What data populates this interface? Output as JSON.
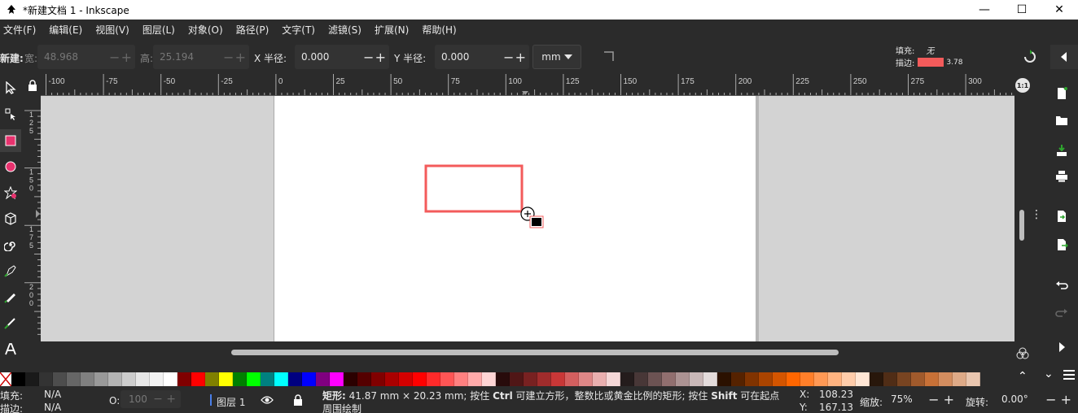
{
  "window": {
    "title": "*新建文档 1 - Inkscape",
    "minimize": "—",
    "maximize": "☐",
    "close": "✕"
  },
  "menu": [
    "文件(F)",
    "编辑(E)",
    "视图(V)",
    "图层(L)",
    "对象(O)",
    "路径(P)",
    "文字(T)",
    "滤镜(S)",
    "扩展(N)",
    "帮助(H)"
  ],
  "controls": {
    "new_label": "新建:",
    "width_label": "宽:",
    "width_value": "48.968",
    "height_label": "高:",
    "height_value": "25.194",
    "rx_label": "X 半径:",
    "rx_value": "0.000",
    "ry_label": "Y 半径:",
    "ry_value": "0.000",
    "unit": "mm",
    "fill_label": "填充:",
    "fill_value": "无",
    "stroke_label": "描边:",
    "stroke_width": "3.78"
  },
  "ruler_top": [
    "-100",
    "-75",
    "-50",
    "-25",
    "0",
    "25",
    "50",
    "75",
    "100",
    "125",
    "150",
    "175",
    "200",
    "225",
    "250",
    "275",
    "300"
  ],
  "ruler_left": [
    "1 2 5",
    "1 5 0",
    "1 7 5",
    "2 0 0"
  ],
  "zoom_reset_label": "1:1",
  "palette": [
    "#000000",
    "#1a1a1a",
    "#333333",
    "#4d4d4d",
    "#666666",
    "#808080",
    "#999999",
    "#b3b3b3",
    "#cccccc",
    "#e6e6e6",
    "#f2f2f2",
    "#ffffff",
    "#800000",
    "#ff0000",
    "#808000",
    "#ffff00",
    "#008000",
    "#00ff00",
    "#008080",
    "#00ffff",
    "#000080",
    "#0000ff",
    "#800080",
    "#ff00ff",
    "#2b0000",
    "#550000",
    "#800000",
    "#aa0000",
    "#d40000",
    "#ff0000",
    "#ff2a2a",
    "#ff5555",
    "#ff8080",
    "#ffaaaa",
    "#ffd5d5",
    "#280b0b",
    "#501616",
    "#782121",
    "#a02c2c",
    "#c83737",
    "#d35f5f",
    "#de8787",
    "#e9afaf",
    "#f4d7d7",
    "#241c1c",
    "#483737",
    "#6c5353",
    "#916f6f",
    "#ac9393",
    "#c8b7b7",
    "#e3dbdb",
    "#2b1100",
    "#552200",
    "#803300",
    "#aa4400",
    "#d45500",
    "#ff6600",
    "#ff7f2a",
    "#ff9955",
    "#ffb380",
    "#ffccaa",
    "#ffe6d5",
    "#28170b",
    "#502d16",
    "#784421",
    "#a05a2c",
    "#c87137",
    "#d38d5f",
    "#deaa87",
    "#e9c6af"
  ],
  "status": {
    "fill_label": "填充:",
    "fill_value": "N/A",
    "stroke_label": "描边:",
    "stroke_value": "N/A",
    "opacity_label": "O:",
    "opacity_value": "100",
    "layer_name": "图层 1",
    "message_line1_a": "矩形:",
    "message_line1_b": "41.87 mm × 20.23 mm; 按住",
    "message_key1": "Ctrl",
    "message_line1_c": "可建立方形，整数比或黄金比例的矩形;  按住",
    "message_key2": "Shift",
    "message_line1_d": "可在起点",
    "message_line2": "周围绘制",
    "x_label": "X:",
    "x_value": "108.23",
    "y_label": "Y:",
    "y_value": "167.13",
    "zoom_label": "缩放:",
    "zoom_value": "75%",
    "rotate_label": "旋转:",
    "rotate_value": "0.00°"
  },
  "colors": {
    "stroke": "#f35b5b",
    "active_tool": "#e8326e"
  }
}
